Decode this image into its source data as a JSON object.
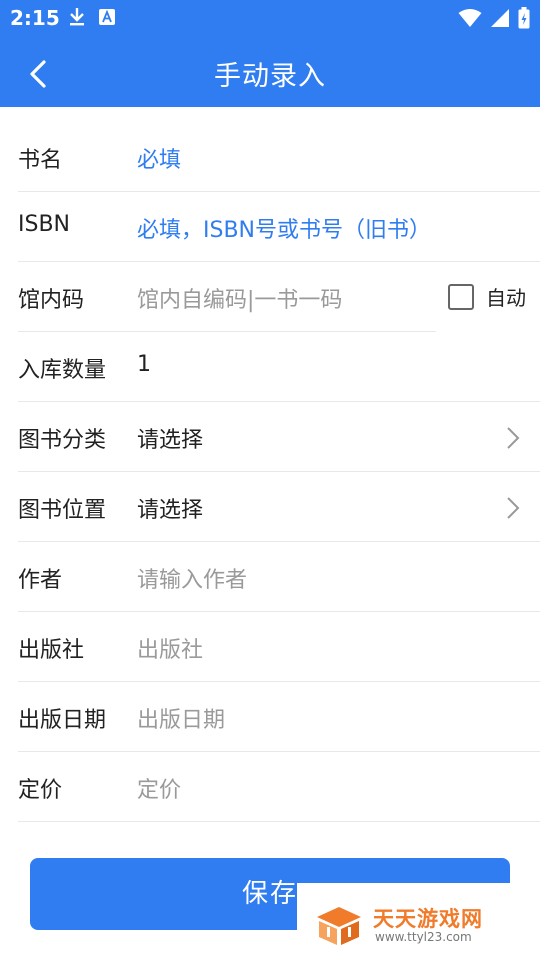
{
  "status_bar": {
    "time": "2:15",
    "left_icons": [
      "download-icon",
      "keyboard-a-icon"
    ],
    "right_icons": [
      "wifi-icon",
      "signal-icon",
      "battery-icon"
    ]
  },
  "app_bar": {
    "title": "手动录入",
    "back_icon": "chevron-left-icon"
  },
  "form": {
    "book_name": {
      "label": "书名",
      "placeholder": "必填"
    },
    "isbn": {
      "label": "ISBN",
      "placeholder": "必填，ISBN号或书号（旧书）"
    },
    "library_code": {
      "label": "馆内码",
      "placeholder": "馆内自编码|一书一码",
      "auto_label": "自动",
      "auto_checked": false
    },
    "quantity": {
      "label": "入库数量",
      "value": "1"
    },
    "category": {
      "label": "图书分类",
      "value": "请选择"
    },
    "location": {
      "label": "图书位置",
      "value": "请选择"
    },
    "author": {
      "label": "作者",
      "placeholder": "请输入作者"
    },
    "publisher": {
      "label": "出版社",
      "placeholder": "出版社"
    },
    "publish_date": {
      "label": "出版日期",
      "placeholder": "出版日期"
    },
    "price": {
      "label": "定价",
      "placeholder": "定价"
    }
  },
  "save_button": {
    "label": "保存"
  },
  "watermark": {
    "title": "天天游戏网",
    "url": "www.ttyl23.com"
  },
  "colors": {
    "accent": "#2f7df1",
    "placeholder": "#9a9a9a",
    "divider": "#e8e8e8"
  }
}
